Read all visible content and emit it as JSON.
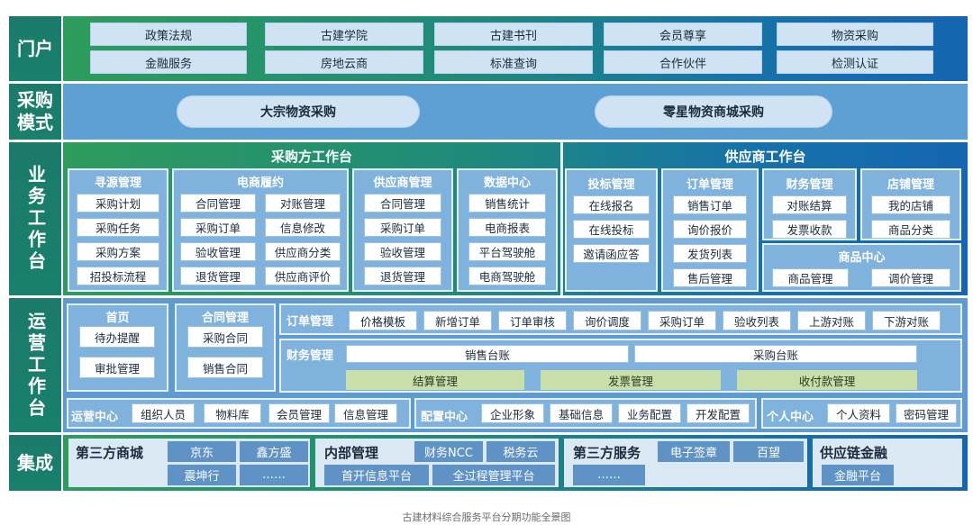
{
  "portal": {
    "label": "门户",
    "items": [
      "政策法规",
      "古建学院",
      "古建书刊",
      "会员尊享",
      "物资采购",
      "金融服务",
      "房地云商",
      "标准查询",
      "合作伙伴",
      "检测认证"
    ]
  },
  "procurement_mode": {
    "label_line1": "采购",
    "label_line2": "模式",
    "items": [
      "大宗物资采购",
      "零星物资商城采购"
    ]
  },
  "business": {
    "label": "业务工作台",
    "buyer": {
      "title": "采购方工作台",
      "sourcing": {
        "title": "寻源管理",
        "items": [
          "采购计划",
          "采购任务",
          "采购方案",
          "招投标流程"
        ]
      },
      "ecommerce": {
        "title": "电商履约",
        "items": [
          "合同管理",
          "对账管理",
          "采购订单",
          "信息修改",
          "验收管理",
          "供应商分类",
          "退货管理",
          "供应商评价"
        ]
      },
      "supplier_mgmt": {
        "title": "供应商管理",
        "items": [
          "合同管理",
          "采购订单",
          "验收管理",
          "退货管理"
        ]
      },
      "data_center": {
        "title": "数据中心",
        "items": [
          "销售统计",
          "电商报表",
          "平台驾驶舱",
          "电商驾驶舱"
        ]
      }
    },
    "supplier": {
      "title": "供应商工作台",
      "bidding": {
        "title": "投标管理",
        "items": [
          "在线报名",
          "在线投标",
          "邀请函应答"
        ]
      },
      "order": {
        "title": "订单管理",
        "items": [
          "销售订单",
          "询价报价",
          "发货列表",
          "售后管理"
        ]
      },
      "finance": {
        "title": "财务管理",
        "items": [
          "对账结算",
          "发票收款"
        ]
      },
      "shop": {
        "title": "店铺管理",
        "items": [
          "我的店铺",
          "商品分类"
        ]
      },
      "goods": {
        "title": "商品中心",
        "items": [
          "商品管理",
          "调价管理"
        ]
      }
    }
  },
  "operations": {
    "label": "运营工作台",
    "home": {
      "title": "首页",
      "items": [
        "待办提醒",
        "审批管理"
      ]
    },
    "contract": {
      "title": "合同管理",
      "items": [
        "采购合同",
        "销售合同"
      ]
    },
    "order_mgmt": {
      "title": "订单管理",
      "items": [
        "价格模板",
        "新增订单",
        "订单审核",
        "询价调度",
        "采购订单",
        "验收列表",
        "上游对账",
        "下游对账"
      ]
    },
    "finance_mgmt": {
      "title": "财务管理",
      "ledgers": [
        "销售台账",
        "采购台账"
      ],
      "green": [
        "结算管理",
        "发票管理",
        "收付款管理"
      ]
    },
    "ops_center": {
      "title": "运营中心",
      "items": [
        "组织人员",
        "物料库",
        "会员管理",
        "信息管理"
      ]
    },
    "config_center": {
      "title": "配置中心",
      "items": [
        "企业形象",
        "基础信息",
        "业务配置",
        "开发配置"
      ]
    },
    "personal_center": {
      "title": "个人中心",
      "items": [
        "个人资料",
        "密码管理"
      ]
    }
  },
  "integration": {
    "label": "集成",
    "third_party_mall": {
      "title": "第三方商城",
      "items": [
        "京东",
        "鑫方盛",
        "震坤行",
        "……"
      ]
    },
    "internal": {
      "title": "内部管理",
      "items": [
        "财务NCC",
        "税务云",
        "首开信息平台",
        "全过程管理平台"
      ]
    },
    "third_party_service": {
      "title": "第三方服务",
      "items": [
        "电子签章",
        "百望",
        "……"
      ]
    },
    "supply_finance": {
      "title": "供应链金融",
      "items": [
        "金融平台"
      ]
    }
  },
  "caption": "古建材料综合服务平台分期功能全景图"
}
